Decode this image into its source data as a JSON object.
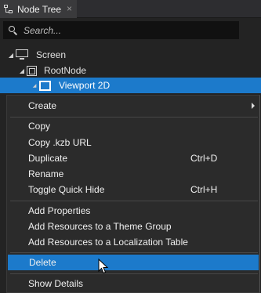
{
  "panel": {
    "tab_title": "Node Tree",
    "tab_close": "×"
  },
  "search": {
    "placeholder": "Search..."
  },
  "tree": {
    "screen": "Screen",
    "root_node": "RootNode",
    "viewport": "Viewport 2D"
  },
  "menu": {
    "create": "Create",
    "copy": "Copy",
    "copy_kzb_url": "Copy .kzb URL",
    "duplicate": "Duplicate",
    "duplicate_shortcut": "Ctrl+D",
    "rename": "Rename",
    "toggle_quick_hide": "Toggle Quick Hide",
    "toggle_quick_hide_shortcut": "Ctrl+H",
    "add_properties": "Add Properties",
    "add_resources_theme": "Add Resources to a Theme Group",
    "add_resources_localization": "Add Resources to a Localization Table",
    "delete": "Delete",
    "show_details": "Show Details"
  },
  "colors": {
    "selection": "#1c7acb",
    "menu_background": "#2b2b2b",
    "panel_background": "#232323"
  }
}
